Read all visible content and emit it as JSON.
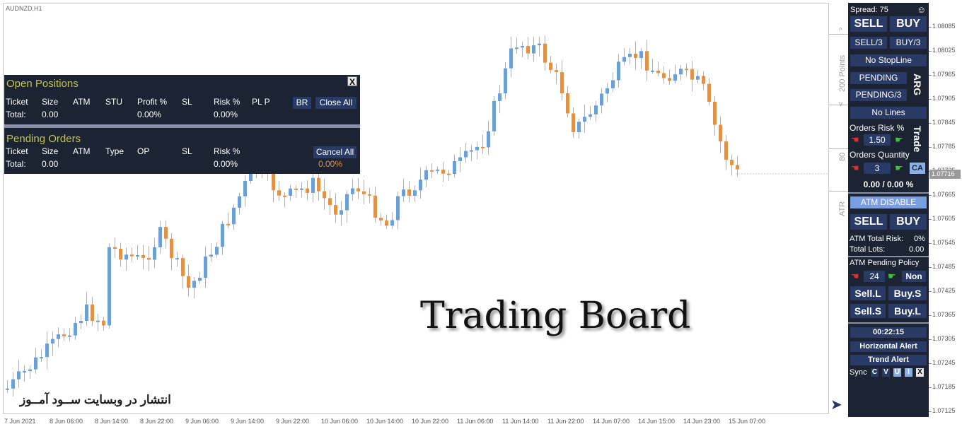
{
  "chart": {
    "symbol": "AUDNZD,H1",
    "prices": [
      "1.08085",
      "1.08025",
      "1.07965",
      "1.07905",
      "1.07845",
      "1.07785",
      "1.07725",
      "1.07665",
      "1.07605",
      "1.07545",
      "1.07485",
      "1.07425",
      "1.07365",
      "1.07305",
      "1.07245",
      "1.07185",
      "1.07125"
    ],
    "current_price": "1.07716",
    "times": [
      "7 Jun 2021",
      "8 Jun 06:00",
      "8 Jun 14:00",
      "8 Jun 22:00",
      "9 Jun 06:00",
      "9 Jun 14:00",
      "9 Jun 22:00",
      "10 Jun 06:00",
      "10 Jun 14:00",
      "10 Jun 22:00",
      "11 Jun 06:00",
      "11 Jun 14:00",
      "11 Jun 22:00",
      "14 Jun 07:00",
      "14 Jun 15:00",
      "14 Jun 23:00",
      "15 Jun 07:00"
    ],
    "side_labels": {
      "points": "200 Points",
      "marker_80": "80",
      "atr": "ATR"
    },
    "colors": {
      "bull": "#6d9ed6",
      "bear": "#e0914a"
    }
  },
  "positions": {
    "open_title": "Open Positions",
    "open_headers": [
      "Ticket",
      "Size",
      "ATM",
      "STU",
      "Profit %",
      "SL",
      "Risk %",
      "PL P"
    ],
    "open_total": {
      "label": "Total:",
      "size": "0.00",
      "profit": "0.00%",
      "risk": "0.00%"
    },
    "br_label": "BR",
    "close_all_label": "Close All",
    "close_x": "X",
    "pending_title": "Pending Orders",
    "pending_headers": [
      "Ticket",
      "Size",
      "ATM",
      "Type",
      "OP",
      "SL",
      "Risk %"
    ],
    "pending_total": {
      "label": "Total:",
      "size": "0.00",
      "risk": "0.00%",
      "extra": "0.00%"
    },
    "cancel_all_label": "Cancel All"
  },
  "watermark": {
    "title": "Trading Board",
    "persian": "انتشار در وبسایت ســود آمــوز"
  },
  "trade_panel": {
    "spread": "Spread: 75",
    "smiley": "☺",
    "sell": "SELL",
    "buy": "BUY",
    "sell3": "SELL/3",
    "buy3": "BUY/3",
    "no_stopline": "No StopLine",
    "pending": "PENDING",
    "pending3": "PENDING/3",
    "arg": "ARG",
    "no_lines": "No Lines",
    "trade_label": "Trade",
    "orders_risk_label": "Orders Risk %",
    "orders_risk_value": "1.50",
    "orders_qty_label": "Orders Quantity",
    "orders_qty_value": "3",
    "ca": "CA",
    "pct": "0.00 / 0.00 %",
    "atm_disable": "ATM DISABLE",
    "sell2": "SELL",
    "buy2": "BUY",
    "atm_total_risk_label": "ATM Total Risk:",
    "atm_total_risk_value": "0%",
    "total_lots_label": "Total Lots:",
    "total_lots_value": "0.00",
    "atm_pending_policy": "ATM Pending Policy",
    "policy_value": "24",
    "policy_non": "Non",
    "sell_l": "Sell.L",
    "buy_s": "Buy.S",
    "sell_s": "Sell.S",
    "buy_l": "Buy.L",
    "timer": "00:22:15",
    "horizontal_alert": "Horizontal Alert",
    "trend_alert": "Trend Alert",
    "sync": "Sync",
    "sync_c": "C",
    "sync_v": "V",
    "sync_u": "U",
    "sync_i": "I",
    "sync_x": "X"
  }
}
